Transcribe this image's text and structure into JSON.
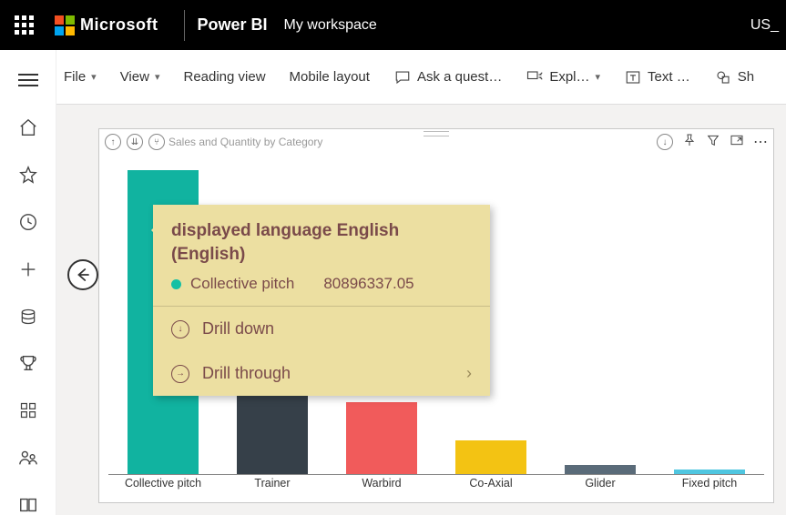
{
  "header": {
    "microsoft": "Microsoft",
    "brand": "Power BI",
    "workspace": "My workspace",
    "user": "US_"
  },
  "toolbar": {
    "file": "File",
    "view": "View",
    "reading": "Reading view",
    "mobile": "Mobile layout",
    "ask": "Ask a quest…",
    "explore": "Expl…",
    "textbox": "Text …",
    "shapes": "Sh"
  },
  "visual": {
    "title": "Sales and Quantity by Category"
  },
  "tooltip": {
    "title": "displayed language English (English)",
    "series_label": "Collective pitch",
    "series_value": "80896337.05",
    "drill_down": "Drill down",
    "drill_through": "Drill through"
  },
  "chart_data": {
    "type": "bar",
    "title": "Sales and Quantity by Category",
    "xlabel": "",
    "ylabel": "",
    "categories": [
      "Collective pitch",
      "Trainer",
      "Warbird",
      "Co-Axial",
      "Glider",
      "Fixed pitch"
    ],
    "values": [
      80896337,
      25000000,
      19000000,
      9000000,
      2500000,
      1200000
    ],
    "colors": [
      "#11b3a0",
      "#364049",
      "#f15b5b",
      "#f3c313",
      "#5a6b79",
      "#4fc6e0"
    ],
    "ylim": [
      0,
      82000000
    ]
  }
}
